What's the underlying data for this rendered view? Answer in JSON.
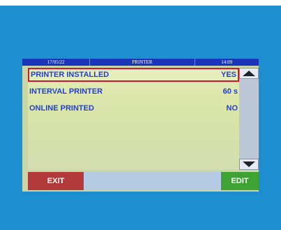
{
  "header": {
    "date": "17/05/22",
    "title": "PRINTER",
    "time": "14:09"
  },
  "rows": [
    {
      "label": "PRINTER INSTALLED",
      "value": "YES",
      "selected": true
    },
    {
      "label": "INTERVAL PRINTER",
      "value": "60 s",
      "selected": false
    },
    {
      "label": "ONLINE PRINTED",
      "value": "NO",
      "selected": false
    }
  ],
  "footer": {
    "exit_label": "EXIT",
    "edit_label": "EDIT"
  },
  "colors": {
    "frame": "#1d8fd0",
    "header_bg": "#1a36b8",
    "text": "#1f3fd8",
    "selection_border": "#d8182a",
    "exit_bg": "#b23a3a",
    "edit_bg": "#3fa334"
  },
  "icons": {
    "scroll_up": "triangle-up-icon",
    "scroll_down": "triangle-down-icon"
  }
}
